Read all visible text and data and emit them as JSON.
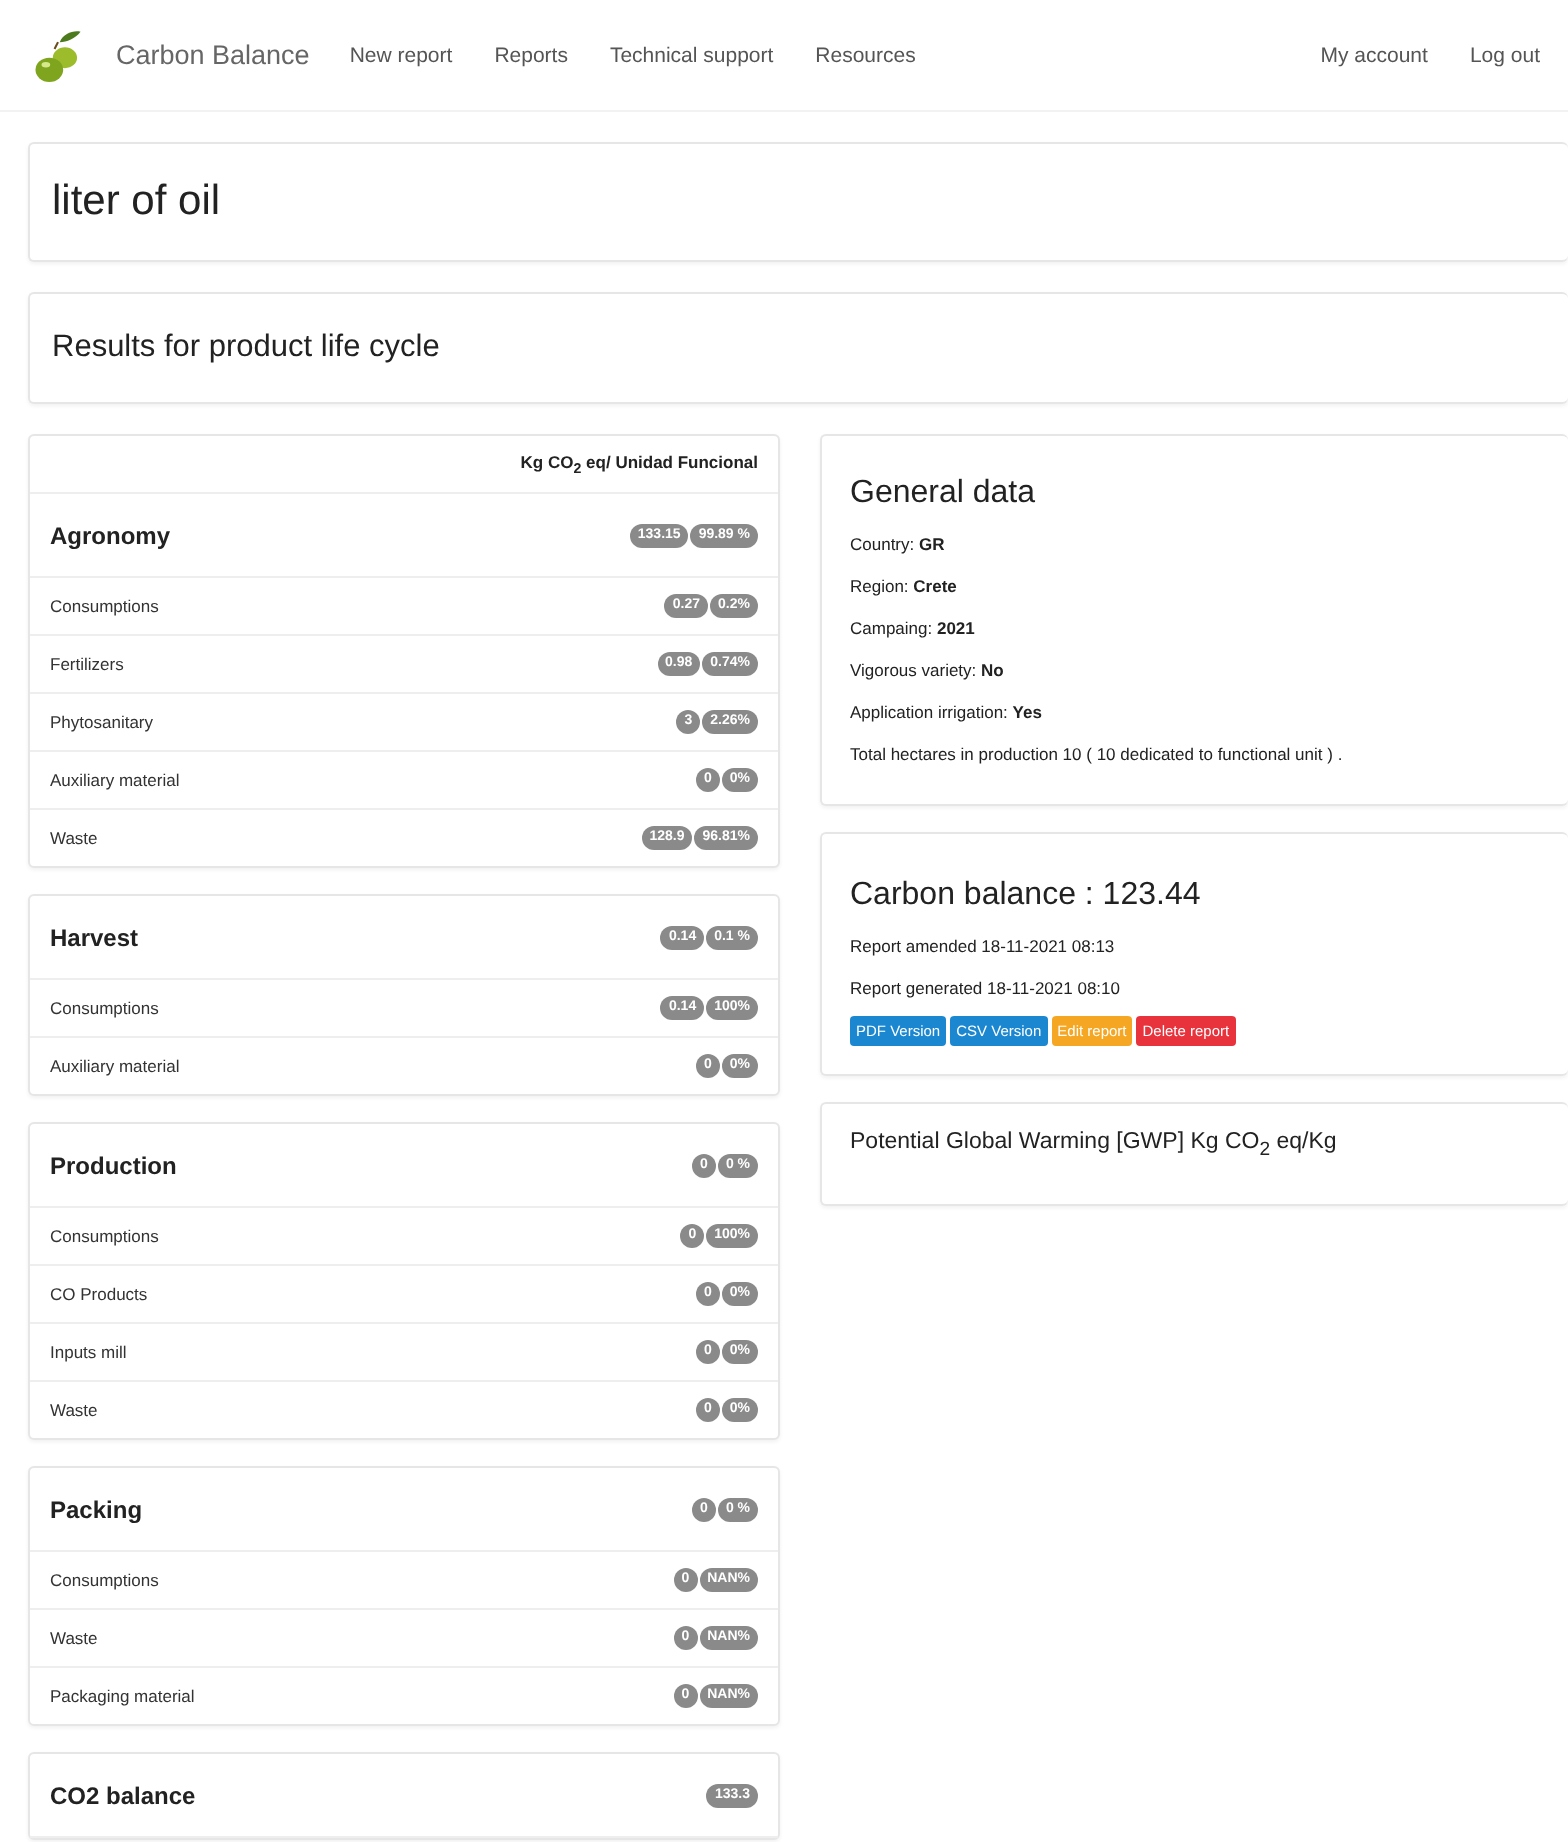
{
  "navbar": {
    "brand": "Carbon Balance",
    "links": [
      "New report",
      "Reports",
      "Technical support",
      "Resources"
    ],
    "right_links": [
      "My account",
      "Log out"
    ]
  },
  "page_title": "liter of oil",
  "subtitle": "Results for product life cycle",
  "results": {
    "unit_header": "Kg CO$_{2}$ eq/ Unidad Funcional",
    "sections": [
      {
        "title": "Agronomy",
        "badges": [
          "133.15",
          "99.89 %"
        ],
        "rows": [
          {
            "label": "Consumptions",
            "badges": [
              "0.27",
              "0.2%"
            ]
          },
          {
            "label": "Fertilizers",
            "badges": [
              "0.98",
              "0.74%"
            ]
          },
          {
            "label": "Phytosanitary",
            "badges": [
              "3",
              "2.26%"
            ]
          },
          {
            "label": "Auxiliary material",
            "badges": [
              "0",
              "0%"
            ]
          },
          {
            "label": "Waste",
            "badges": [
              "128.9",
              "96.81%"
            ]
          }
        ]
      },
      {
        "title": "Harvest",
        "badges": [
          "0.14",
          "0.1 %"
        ],
        "rows": [
          {
            "label": "Consumptions",
            "badges": [
              "0.14",
              "100%"
            ]
          },
          {
            "label": "Auxiliary material",
            "badges": [
              "0",
              "0%"
            ]
          }
        ]
      },
      {
        "title": "Production",
        "badges": [
          "0",
          "0 %"
        ],
        "rows": [
          {
            "label": "Consumptions",
            "badges": [
              "0",
              "100%"
            ]
          },
          {
            "label": "CO Products",
            "badges": [
              "0",
              "0%"
            ]
          },
          {
            "label": "Inputs mill",
            "badges": [
              "0",
              "0%"
            ]
          },
          {
            "label": "Waste",
            "badges": [
              "0",
              "0%"
            ]
          }
        ]
      },
      {
        "title": "Packing",
        "badges": [
          "0",
          "0 %"
        ],
        "rows": [
          {
            "label": "Consumptions",
            "badges": [
              "0",
              "NAN%"
            ]
          },
          {
            "label": "Waste",
            "badges": [
              "0",
              "NAN%"
            ]
          },
          {
            "label": "Packaging material",
            "badges": [
              "0",
              "NAN%"
            ]
          }
        ]
      },
      {
        "title": "CO2 balance",
        "badges": [
          "133.3"
        ]
      }
    ]
  },
  "general_data": {
    "title": "General data",
    "lines": [
      "Country: **GR**",
      "Region: **Crete**",
      "Campaing: **2021**",
      "Vigorous variety: **No**",
      "Application irrigation: **Yes**",
      "Total hectares in production 10 ( 10 dedicated to functional unit ) ."
    ]
  },
  "carbon_balance": {
    "title": "Carbon balance : 123.44",
    "lines": [
      "Report amended 18-11-2021 08:13",
      "Report generated 18-11-2021 08:10"
    ],
    "buttons": [
      {
        "label": "PDF Version",
        "kind": "primary"
      },
      {
        "label": "CSV Version",
        "kind": "primary"
      },
      {
        "label": "Edit report",
        "kind": "warning"
      },
      {
        "label": "Delete report",
        "kind": "danger"
      }
    ]
  },
  "gwp": {
    "title": "Potential Global Warming [GWP] Kg CO$_{2}$  eq/Kg"
  }
}
